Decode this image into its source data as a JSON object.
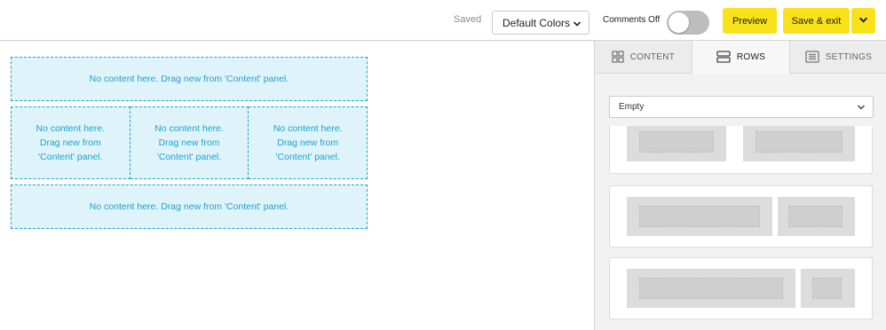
{
  "topbar": {
    "saved_status": "Saved",
    "color_scheme": {
      "selected": "Default Colors",
      "icon": "chevron-down-icon"
    },
    "comments_label": "Comments Off",
    "comments_enabled": false,
    "preview_label": "Preview",
    "save_exit_label": "Save & exit",
    "save_menu_icon": "chevron-down-icon",
    "accent_color": "#f9e21a"
  },
  "canvas": {
    "rows": [
      {
        "cells": [
          "No content here. Drag new from 'Content' panel."
        ]
      },
      {
        "cells": [
          [
            "No content here.",
            "Drag new from",
            "'Content' panel."
          ],
          [
            "No content here.",
            "Drag new from",
            "'Content' panel."
          ],
          [
            "No content here.",
            "Drag new from",
            "'Content' panel."
          ]
        ]
      },
      {
        "cells": [
          "No content here. Drag new from 'Content' panel."
        ]
      }
    ],
    "placeholder_color": "#1da3cd"
  },
  "panel": {
    "tabs": [
      {
        "label": "CONTENT",
        "icon": "grid-icon",
        "active": false
      },
      {
        "label": "ROWS",
        "icon": "rows-icon",
        "active": true
      },
      {
        "label": "SETTINGS",
        "icon": "settings-list-icon",
        "active": false
      }
    ],
    "row_filter": {
      "selected": "Empty",
      "icon": "chevron-down-icon"
    },
    "row_layouts": [
      {
        "name": "two-equal-columns",
        "column_ratios": [
          1,
          1
        ]
      },
      {
        "name": "two-thirds-one-third",
        "column_ratios": [
          2,
          1
        ]
      },
      {
        "name": "three-quarters-one-quarter",
        "column_ratios": [
          3,
          1
        ]
      }
    ]
  }
}
